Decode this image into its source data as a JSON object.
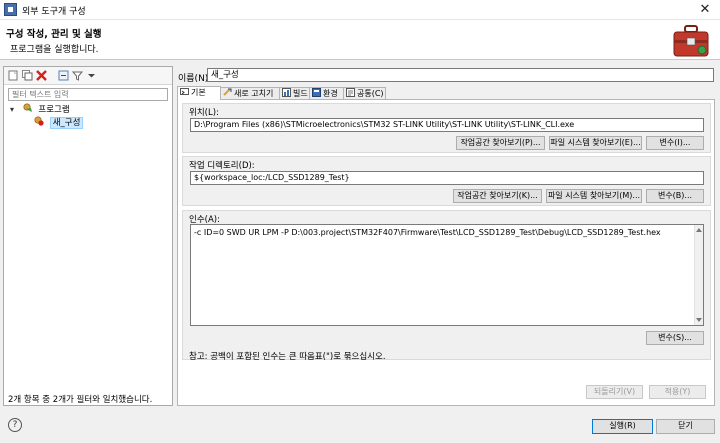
{
  "window": {
    "title": "외부 도구개 구성",
    "close_glyph": "✕"
  },
  "header": {
    "title": "구성 작성, 관리 및 실행",
    "description": "프로그램을 실행합니다."
  },
  "left": {
    "filter_placeholder": "필터 텍스트 입력",
    "tree": [
      {
        "label": "프로그램",
        "expanded": true
      },
      {
        "label": "새_구성",
        "selected": true
      }
    ],
    "status": "2개 항목 중 2개가 필터와 일치했습니다."
  },
  "config": {
    "name_label": "이름(N):",
    "name_value": "새_구성",
    "tabs": [
      {
        "label": "기본",
        "active": true
      },
      {
        "label": "새로 고치기"
      },
      {
        "label": "빌드"
      },
      {
        "label": "환경"
      },
      {
        "label": "공통(C)"
      }
    ],
    "location": {
      "label": "위치(L):",
      "value": "D:\\Program Files (x86)\\STMicroelectronics\\STM32 ST-LINK Utility\\ST-LINK Utility\\ST-LINK_CLI.exe",
      "buttons": [
        "작업공간 찾아보기(P)...",
        "파일 시스템 찾아보기(E)...",
        "변수(I)..."
      ]
    },
    "workdir": {
      "label": "작업 디렉토리(D):",
      "value": "${workspace_loc:/LCD_SSD1289_Test}",
      "buttons": [
        "작업공간 찾아보기(K)...",
        "파일 시스템 찾아보기(M)...",
        "변수(B)..."
      ]
    },
    "args": {
      "label": "인수(A):",
      "value": "-c ID=0 SWD UR LPM -P D:\\003.project\\STM32F407\\Firmware\\Test\\LCD_SSD1289_Test\\Debug\\LCD_SSD1289_Test.hex",
      "variables_button": "변수(S)...",
      "note": "참고: 공백이 포함된 인수는 큰 따옴표(\")로 묶으십시오."
    },
    "revert_button": "되돌리기(V)",
    "apply_button": "적용(Y)"
  },
  "footer": {
    "run_button": "실행(R)",
    "close_button": "닫기"
  },
  "colors": {
    "accent": "#0078d7",
    "selection": "#cce8ff",
    "toolbox_red": "#c0392b"
  }
}
